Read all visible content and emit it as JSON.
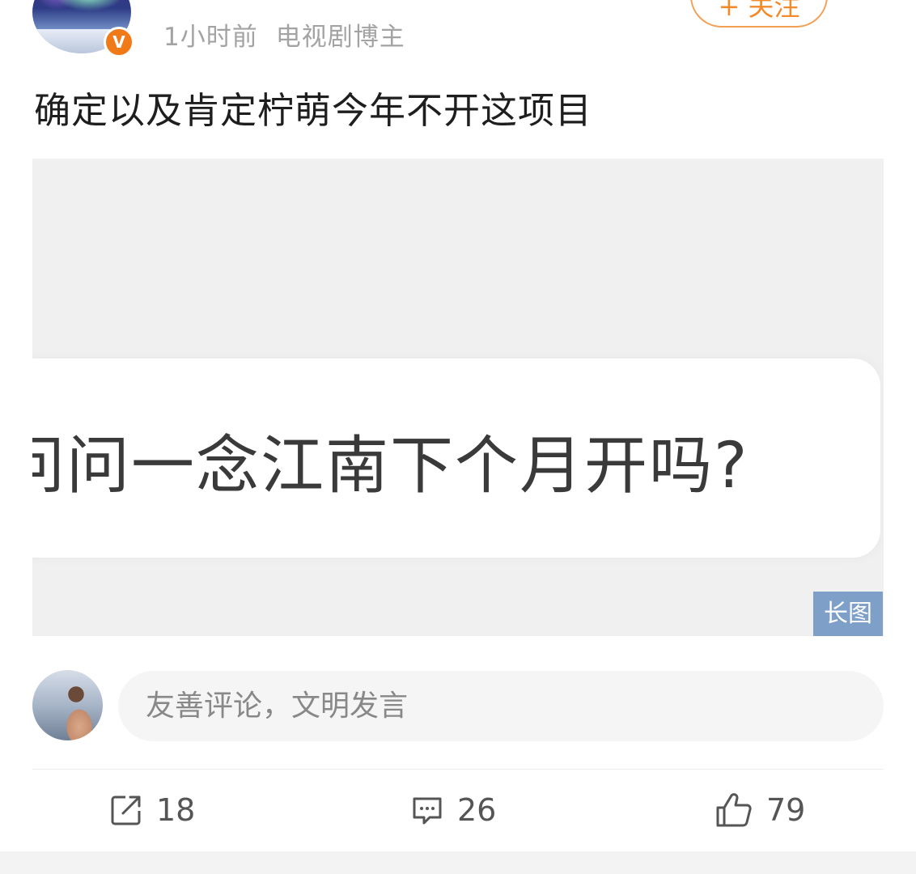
{
  "header": {
    "time_ago": "1小时前",
    "user_tag": "电视剧博主",
    "verified_badge": "V",
    "follow_label": "+ 关注"
  },
  "post": {
    "text": "确定以及肯定柠萌今年不开这项目",
    "image_text": "问问一念江南下个月开吗?",
    "long_image_tag": "长图"
  },
  "comment": {
    "placeholder": "友善评论，文明发言"
  },
  "actions": {
    "share_count": "18",
    "comment_count": "26",
    "like_count": "79"
  },
  "icons": {
    "share": "share-icon",
    "comment": "comment-icon",
    "like": "thumbs-up-icon"
  },
  "colors": {
    "accent_orange": "#f08a2a",
    "long_tag_bg": "#7e9fc8"
  }
}
